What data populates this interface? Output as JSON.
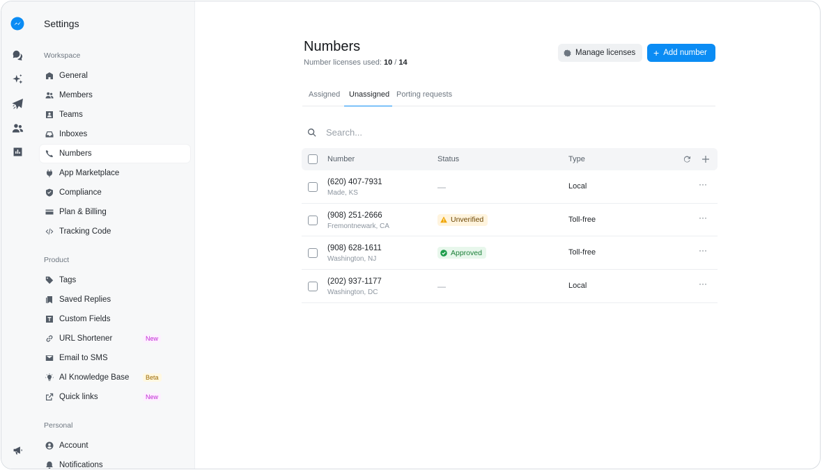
{
  "app": {
    "logo_icon": "chat-bubble-logo-icon",
    "accent": "#0b8cf4"
  },
  "rail": {
    "icons": [
      "inbox-icon",
      "sparkle-icon",
      "campaign-icon",
      "contacts-icon",
      "analytics-icon",
      "megaphone-icon"
    ]
  },
  "sidebar": {
    "title": "Settings",
    "sections": [
      {
        "label": "Workspace",
        "items": [
          {
            "label": "General",
            "icon": "building-icon"
          },
          {
            "label": "Members",
            "icon": "people-icon"
          },
          {
            "label": "Teams",
            "icon": "team-icon"
          },
          {
            "label": "Inboxes",
            "icon": "inbox-tray-icon"
          },
          {
            "label": "Numbers",
            "icon": "phone-icon",
            "active": true
          },
          {
            "label": "App Marketplace",
            "icon": "plug-icon"
          },
          {
            "label": "Compliance",
            "icon": "shield-icon"
          },
          {
            "label": "Plan & Billing",
            "icon": "credit-card-icon"
          },
          {
            "label": "Tracking Code",
            "icon": "code-icon"
          }
        ]
      },
      {
        "label": "Product",
        "items": [
          {
            "label": "Tags",
            "icon": "tag-icon"
          },
          {
            "label": "Saved Replies",
            "icon": "bookmark-icon"
          },
          {
            "label": "Custom Fields",
            "icon": "text-field-icon"
          },
          {
            "label": "URL Shortener",
            "icon": "link-icon",
            "badge": "New"
          },
          {
            "label": "Email to SMS",
            "icon": "envelope-icon"
          },
          {
            "label": "AI Knowledge Base",
            "icon": "lightbulb-icon",
            "badge": "Beta"
          },
          {
            "label": "Quick links",
            "icon": "external-link-icon",
            "badge": "New"
          }
        ]
      },
      {
        "label": "Personal",
        "items": [
          {
            "label": "Account",
            "icon": "user-circle-icon"
          },
          {
            "label": "Notifications",
            "icon": "bell-icon"
          }
        ]
      }
    ]
  },
  "header": {
    "title": "Numbers",
    "licenses_label": "Number licenses used:",
    "licenses_used": "10",
    "licenses_sep": "/",
    "licenses_total": "14",
    "manage_label": "Manage licenses",
    "add_label": "Add number"
  },
  "tabs": [
    {
      "label": "Assigned"
    },
    {
      "label": "Unassigned",
      "active": true
    },
    {
      "label": "Porting requests"
    }
  ],
  "search": {
    "placeholder": "Search..."
  },
  "table": {
    "columns": [
      "Number",
      "Status",
      "Type"
    ],
    "rows": [
      {
        "number": "(620) 407-7931",
        "location": "Made, KS",
        "status": "—",
        "status_kind": "none",
        "type": "Local",
        "more": "···"
      },
      {
        "number": "(908) 251-2666",
        "location": "Fremontnewark, CA",
        "status": "Unverified",
        "status_kind": "warning",
        "type": "Toll-free",
        "more": "···"
      },
      {
        "number": "(908) 628-1611",
        "location": "Washington, NJ",
        "status": "Approved",
        "status_kind": "success",
        "type": "Toll-free",
        "more": "···"
      },
      {
        "number": "(202) 937-1177",
        "location": "Washington, DC",
        "status": "—",
        "status_kind": "none",
        "type": "Local",
        "more": "···"
      }
    ]
  }
}
